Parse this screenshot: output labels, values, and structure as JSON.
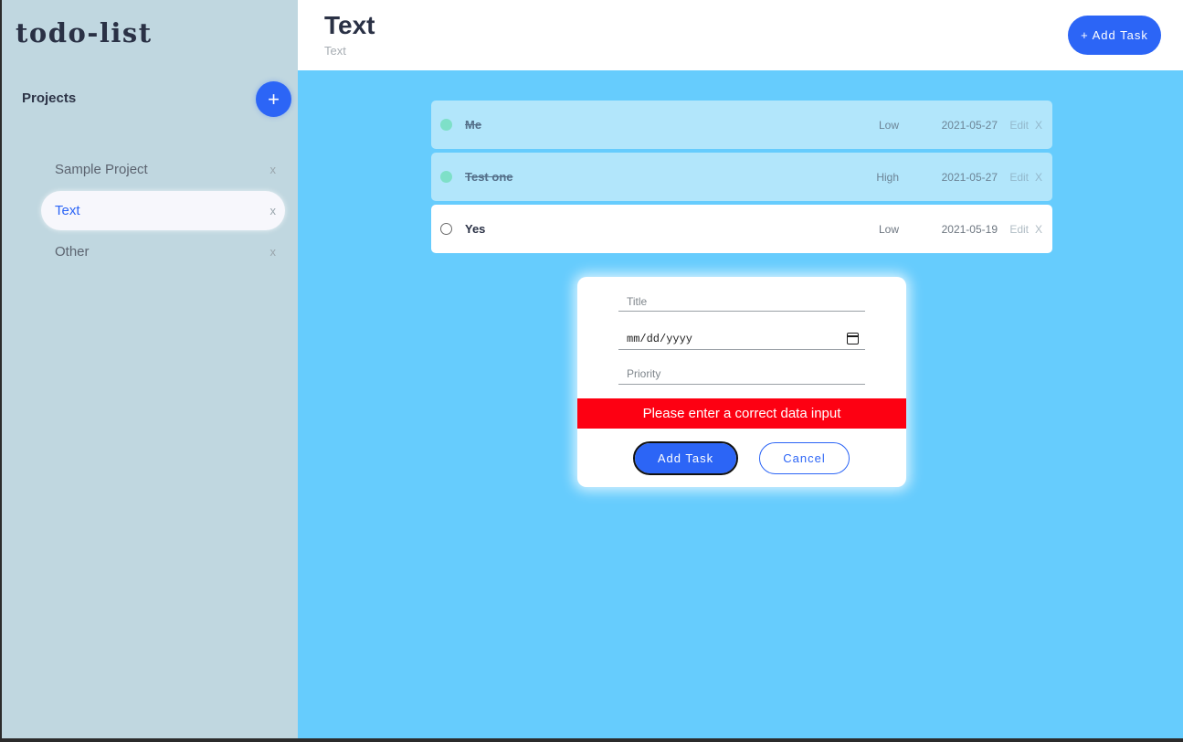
{
  "sidebar": {
    "brand": "todo-list",
    "projects_heading": "Projects",
    "add_project_label": "+",
    "projects": [
      {
        "name": "Sample Project",
        "remove_label": "x",
        "active": false
      },
      {
        "name": "Text",
        "remove_label": "x",
        "active": true
      },
      {
        "name": "Other",
        "remove_label": "x",
        "active": false
      }
    ]
  },
  "header": {
    "title": "Text",
    "subtitle": "Text",
    "add_task_label": "+ Add Task"
  },
  "tasks": [
    {
      "title": "Me",
      "priority": "Low",
      "date": "2021-05-27",
      "edit_label": "Edit",
      "remove_label": "X",
      "completed": true
    },
    {
      "title": "Test one",
      "priority": "High",
      "date": "2021-05-27",
      "edit_label": "Edit",
      "remove_label": "X",
      "completed": true
    },
    {
      "title": "Yes",
      "priority": "Low",
      "date": "2021-05-19",
      "edit_label": "Edit",
      "remove_label": "X",
      "completed": false
    }
  ],
  "form": {
    "title_placeholder": "Title",
    "title_value": "",
    "date_placeholder": "mm/dd/yyyy",
    "priority_placeholder": "Priority",
    "priority_value": "",
    "error_message": "Please enter a correct data input",
    "submit_label": "Add Task",
    "cancel_label": "Cancel"
  },
  "colors": {
    "accent": "#2c65f6",
    "main_background": "#66ccfd",
    "sidebar_background": "#c0d7e0",
    "error": "#fd0012",
    "completed_task": "#b2e6fb",
    "completed_check": "#7ee0c8"
  }
}
